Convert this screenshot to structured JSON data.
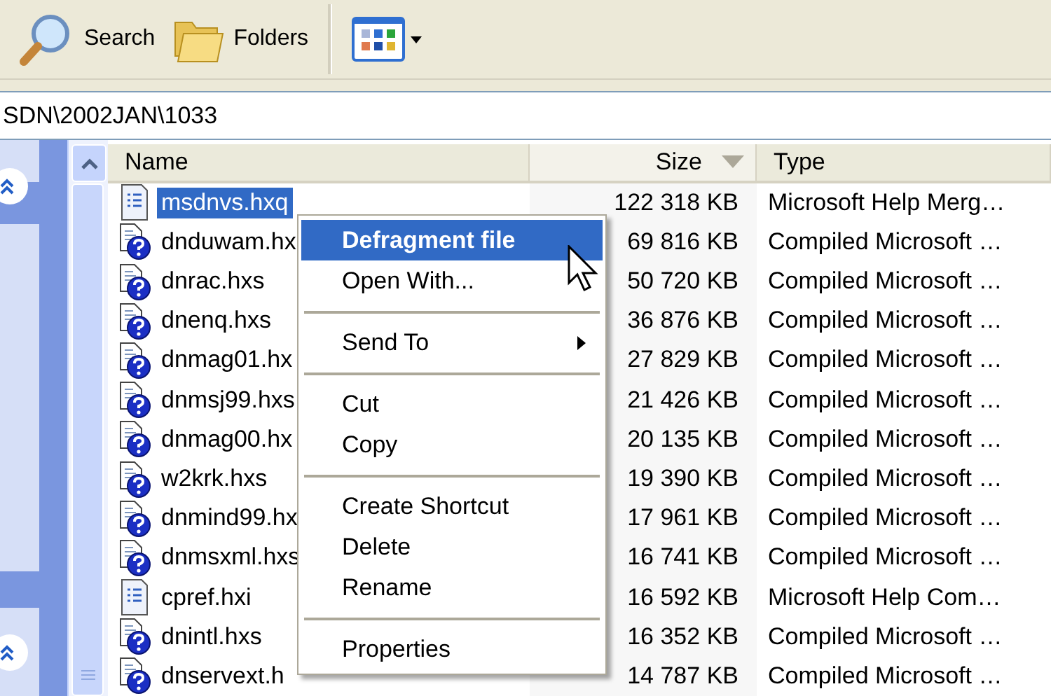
{
  "toolbar": {
    "buttons": [
      {
        "kind": "search",
        "label": "Search"
      },
      {
        "kind": "folders",
        "label": "Folders"
      },
      {
        "kind": "views"
      }
    ]
  },
  "address": {
    "value": "SDN\\2002JAN\\1033"
  },
  "table": {
    "columns": [
      {
        "label": "Name",
        "sorted": false
      },
      {
        "label": "Size",
        "sorted": true
      },
      {
        "label": "Type",
        "sorted": false
      }
    ],
    "rows": [
      {
        "kind": "document",
        "name": "msdnvs.hxq",
        "size": "122 318 KB",
        "type": "Microsoft Help Merg…",
        "selected": true
      },
      {
        "kind": "help",
        "name": "dnduwam.hx",
        "size": "69 816 KB",
        "type": "Compiled Microsoft …",
        "selected": false
      },
      {
        "kind": "help",
        "name": "dnrac.hxs",
        "size": "50 720 KB",
        "type": "Compiled Microsoft …",
        "selected": false
      },
      {
        "kind": "help",
        "name": "dnenq.hxs",
        "size": "36 876 KB",
        "type": "Compiled Microsoft …",
        "selected": false
      },
      {
        "kind": "help",
        "name": "dnmag01.hx",
        "size": "27 829 KB",
        "type": "Compiled Microsoft …",
        "selected": false
      },
      {
        "kind": "help",
        "name": "dnmsj99.hxs",
        "size": "21 426 KB",
        "type": "Compiled Microsoft …",
        "selected": false
      },
      {
        "kind": "help",
        "name": "dnmag00.hx",
        "size": "20 135 KB",
        "type": "Compiled Microsoft …",
        "selected": false
      },
      {
        "kind": "help",
        "name": "w2krk.hxs",
        "size": "19 390 KB",
        "type": "Compiled Microsoft …",
        "selected": false
      },
      {
        "kind": "help",
        "name": "dnmind99.hx",
        "size": "17 961 KB",
        "type": "Compiled Microsoft …",
        "selected": false
      },
      {
        "kind": "help",
        "name": "dnmsxml.hxs",
        "size": "16 741 KB",
        "type": "Compiled Microsoft …",
        "selected": false
      },
      {
        "kind": "document",
        "name": "cpref.hxi",
        "size": "16 592 KB",
        "type": "Microsoft Help Com…",
        "selected": false
      },
      {
        "kind": "help",
        "name": "dnintl.hxs",
        "size": "16 352 KB",
        "type": "Compiled Microsoft …",
        "selected": false
      },
      {
        "kind": "help",
        "name": "dnservext.h",
        "size": "14 787 KB",
        "type": "Compiled Microsoft …",
        "selected": false
      }
    ]
  },
  "context_menu": {
    "items": [
      {
        "kind": "item",
        "label": "Defragment file",
        "selected": true,
        "default": true,
        "submenu": false
      },
      {
        "kind": "item",
        "label": "Open With...",
        "selected": false,
        "default": false,
        "submenu": false
      },
      {
        "kind": "separator"
      },
      {
        "kind": "item",
        "label": "Send To",
        "selected": false,
        "default": false,
        "submenu": true
      },
      {
        "kind": "separator"
      },
      {
        "kind": "item",
        "label": "Cut",
        "selected": false,
        "default": false,
        "submenu": false
      },
      {
        "kind": "item",
        "label": "Copy",
        "selected": false,
        "default": false,
        "submenu": false
      },
      {
        "kind": "separator"
      },
      {
        "kind": "item",
        "label": "Create Shortcut",
        "selected": false,
        "default": false,
        "submenu": false
      },
      {
        "kind": "item",
        "label": "Delete",
        "selected": false,
        "default": false,
        "submenu": false
      },
      {
        "kind": "item",
        "label": "Rename",
        "selected": false,
        "default": false,
        "submenu": false
      },
      {
        "kind": "separator"
      },
      {
        "kind": "item",
        "label": "Properties",
        "selected": false,
        "default": false,
        "submenu": false
      }
    ]
  }
}
